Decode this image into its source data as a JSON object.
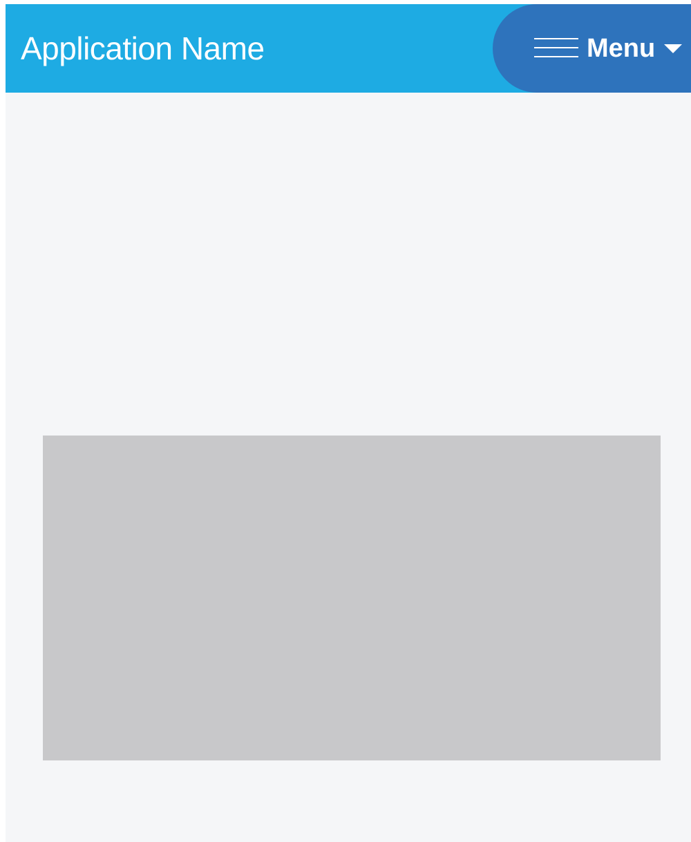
{
  "header": {
    "app_title": "Application Name",
    "menu_label": "Menu"
  },
  "icons": {
    "hamburger": "hamburger-icon",
    "caret": "caret-down-icon"
  },
  "colors": {
    "header_bg": "#1eabe3",
    "menu_bg": "#2e73bc",
    "page_bg": "#f5f6f8",
    "placeholder_bg": "#c8c8ca",
    "text": "#ffffff"
  }
}
